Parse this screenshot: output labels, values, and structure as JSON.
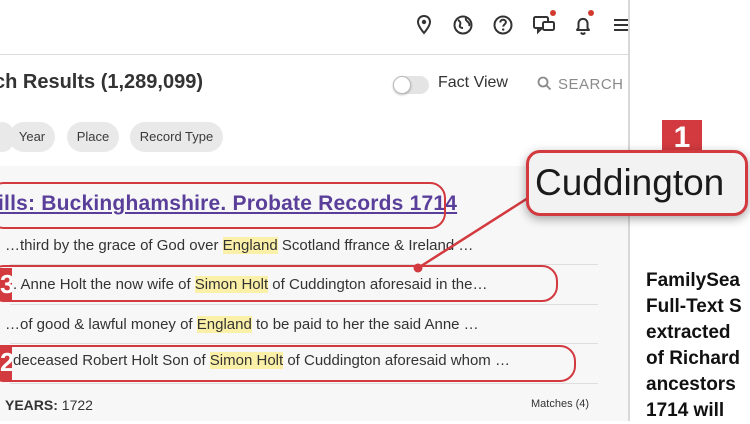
{
  "header": {
    "icons": [
      "location-pin-icon",
      "globe-icon",
      "help-icon",
      "chat-icon",
      "bell-icon",
      "menu-icon"
    ]
  },
  "results": {
    "title": "ch Results (1,289,099)",
    "fact_view_label": "Fact View",
    "search_label": "SEARCH"
  },
  "filters": [
    "Year",
    "Place",
    "Record Type"
  ],
  "record": {
    "title": "ills: Buckinghamshire. Probate Records 1714",
    "snippets": [
      {
        "parts": [
          {
            "t": "…third by the grace of God over "
          },
          {
            "t": "England",
            "hl": true
          },
          {
            "t": " Scotland ffrance & Ireland …"
          }
        ]
      },
      {
        "parts": [
          {
            "t": ". Anne Holt the now wife of "
          },
          {
            "t": "Simon Holt",
            "hl": true
          },
          {
            "t": " of Cuddington aforesaid in the…"
          }
        ]
      },
      {
        "parts": [
          {
            "t": "…of good & lawful money of "
          },
          {
            "t": "England",
            "hl": true
          },
          {
            "t": " to be paid to her the said Anne …"
          }
        ]
      },
      {
        "parts": [
          {
            "t": " deceased Robert Holt Son of "
          },
          {
            "t": "Simon Holt",
            "hl": true
          },
          {
            "t": " of Cuddington aforesaid whom …"
          }
        ]
      }
    ],
    "years_label": "YEARS:",
    "years_value": "1722",
    "matches": "Matches (4)"
  },
  "annotations": {
    "tag1": "1",
    "tag2": "2",
    "tag3": "3",
    "callout": "Cuddington"
  },
  "article_lines": [
    "FamilySea",
    "Full-Text S",
    "extracted",
    "of Richard",
    "ancestors",
    "1714 will"
  ]
}
